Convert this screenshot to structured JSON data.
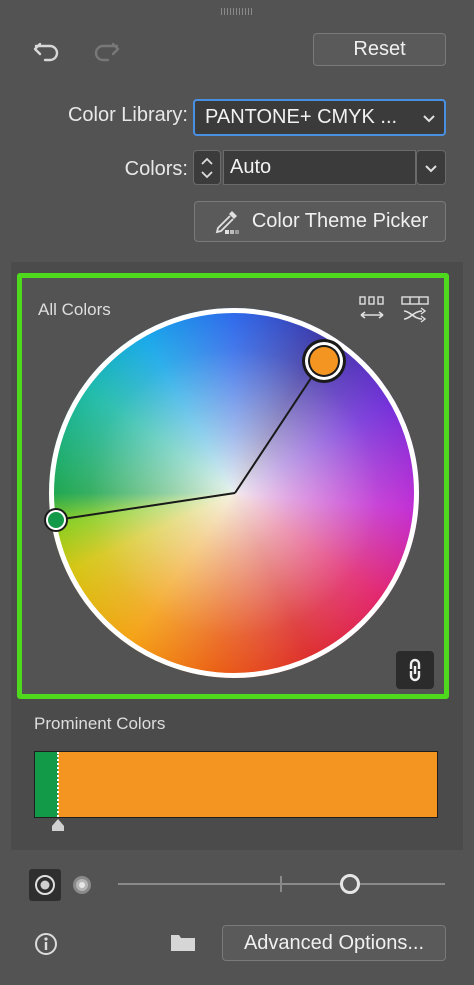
{
  "toolbar": {
    "reset_label": "Reset"
  },
  "settings": {
    "library_label": "Color Library:",
    "library_value": "PANTONE+ CMYK ...",
    "colors_label": "Colors:",
    "colors_value": "Auto",
    "theme_picker_label": "Color Theme Picker"
  },
  "wheel": {
    "title": "All Colors",
    "handles": [
      {
        "name": "orange",
        "color": "#f39520"
      },
      {
        "name": "green",
        "color": "#129a49"
      }
    ],
    "link_icon": "link-icon"
  },
  "prominent": {
    "title": "Prominent Colors",
    "swatches": [
      {
        "color": "#129a49",
        "share": 0.07
      },
      {
        "color": "#f39520",
        "share": 0.93
      }
    ]
  },
  "footer": {
    "advanced_label": "Advanced Options...",
    "saturation_value": 0.71
  },
  "colors": {
    "accent_highlight": "#4fd91c",
    "focus_ring": "#4a90e2"
  }
}
